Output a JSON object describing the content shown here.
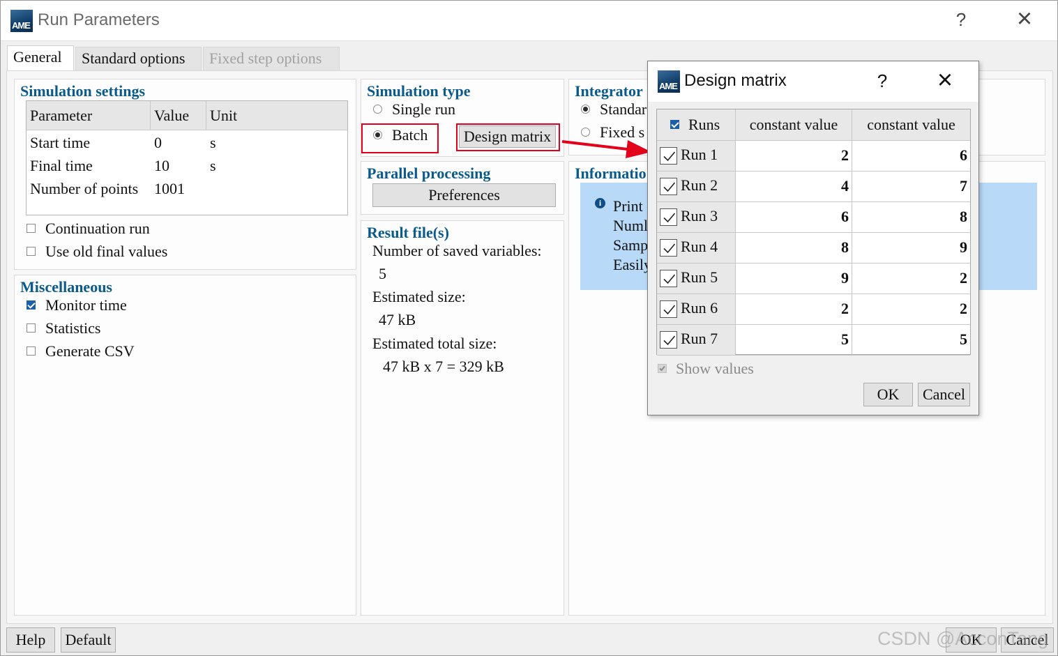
{
  "window": {
    "title": "Run Parameters",
    "logo_text": "AME",
    "help_symbol": "?",
    "close_symbol": "×"
  },
  "tabs": [
    {
      "label": "General"
    },
    {
      "label": "Standard options"
    },
    {
      "label": "Fixed step options"
    }
  ],
  "simulation_settings": {
    "title": "Simulation settings",
    "columns": [
      "Parameter",
      "Value",
      "Unit"
    ],
    "rows": [
      {
        "parameter": "Start time",
        "value": "0",
        "unit": "s"
      },
      {
        "parameter": "Final time",
        "value": "10",
        "unit": "s"
      },
      {
        "parameter": "Number of points",
        "value": "1001",
        "unit": ""
      }
    ],
    "continuation_run": "Continuation run",
    "use_old_final_values": "Use old final values"
  },
  "miscellaneous": {
    "title": "Miscellaneous",
    "monitor_time": "Monitor time",
    "statistics": "Statistics",
    "generate_csv": "Generate CSV"
  },
  "simulation_type": {
    "title": "Simulation type",
    "single_run": "Single run",
    "batch": "Batch",
    "design_matrix_button": "Design matrix"
  },
  "parallel_processing": {
    "title": "Parallel processing",
    "preferences_button": "Preferences"
  },
  "result_files": {
    "title": "Result file(s)",
    "saved_variables_label": "Number of saved variables:",
    "saved_variables_value": "5",
    "estimated_size_label": "Estimated size:",
    "estimated_size_value": "47 kB",
    "estimated_total_label": "Estimated total size:",
    "estimated_total_value": "47 kB x 7 = 329 kB"
  },
  "integrator": {
    "title": "Integrator",
    "standard": "Standar",
    "fixed": "Fixed s"
  },
  "information": {
    "title": "Informatio",
    "lines": [
      "Print",
      "Numl",
      "Samp",
      "Easily"
    ]
  },
  "footer": {
    "help_button": "Help",
    "default_button": "Default",
    "ok_button": "OK",
    "cancel_button": "Cancel"
  },
  "design_matrix": {
    "title": "Design matrix",
    "help_symbol": "?",
    "close_symbol": "×",
    "runs_header": "Runs",
    "columns": [
      "constant value",
      "constant value"
    ],
    "rows": [
      {
        "label": "Run 1",
        "v1": "2",
        "v2": "6"
      },
      {
        "label": "Run 2",
        "v1": "4",
        "v2": "7"
      },
      {
        "label": "Run 3",
        "v1": "6",
        "v2": "8"
      },
      {
        "label": "Run 4",
        "v1": "8",
        "v2": "9"
      },
      {
        "label": "Run 5",
        "v1": "9",
        "v2": "2"
      },
      {
        "label": "Run 6",
        "v1": "2",
        "v2": "2"
      },
      {
        "label": "Run 7",
        "v1": "5",
        "v2": "5"
      }
    ],
    "show_values": "Show values",
    "ok_button": "OK",
    "cancel_button": "Cancel"
  },
  "watermark": "CSDN @AcconTang",
  "colors": {
    "group_title": "#0a5a8a",
    "highlight_red": "#e3001b",
    "info_background": "#b8daf8",
    "checkbox_checked": "#1a5fa8"
  }
}
